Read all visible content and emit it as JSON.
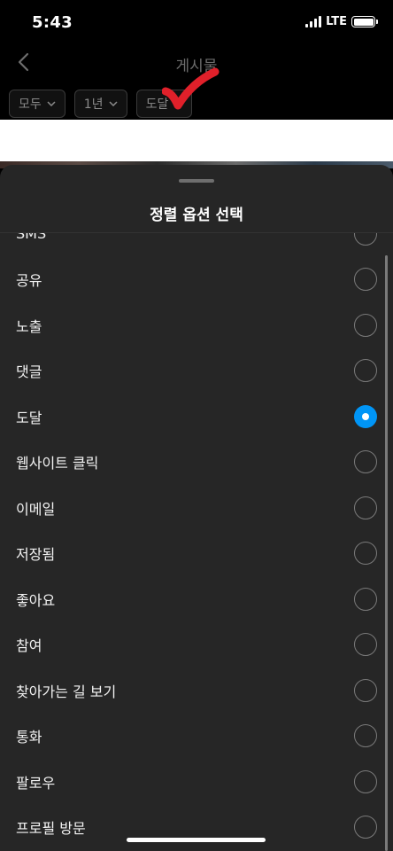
{
  "status": {
    "time": "5:43",
    "network": "LTE"
  },
  "header": {
    "title": "게시물"
  },
  "filters": [
    {
      "label": "모두"
    },
    {
      "label": "1년"
    },
    {
      "label": "도달"
    }
  ],
  "sheet": {
    "title": "정렬 옵션 선택",
    "selected": "도달",
    "options": [
      {
        "label": "SMS",
        "selected": false
      },
      {
        "label": "공유",
        "selected": false
      },
      {
        "label": "노출",
        "selected": false
      },
      {
        "label": "댓글",
        "selected": false
      },
      {
        "label": "도달",
        "selected": true
      },
      {
        "label": "웹사이트 클릭",
        "selected": false
      },
      {
        "label": "이메일",
        "selected": false
      },
      {
        "label": "저장됨",
        "selected": false
      },
      {
        "label": "좋아요",
        "selected": false
      },
      {
        "label": "참여",
        "selected": false
      },
      {
        "label": "찾아가는 길 보기",
        "selected": false
      },
      {
        "label": "통화",
        "selected": false
      },
      {
        "label": "팔로우",
        "selected": false
      },
      {
        "label": "프로필 방문",
        "selected": false
      }
    ]
  },
  "colors": {
    "accent": "#0095f6",
    "annotation": "#e0202a",
    "sheet_bg": "#262626"
  }
}
